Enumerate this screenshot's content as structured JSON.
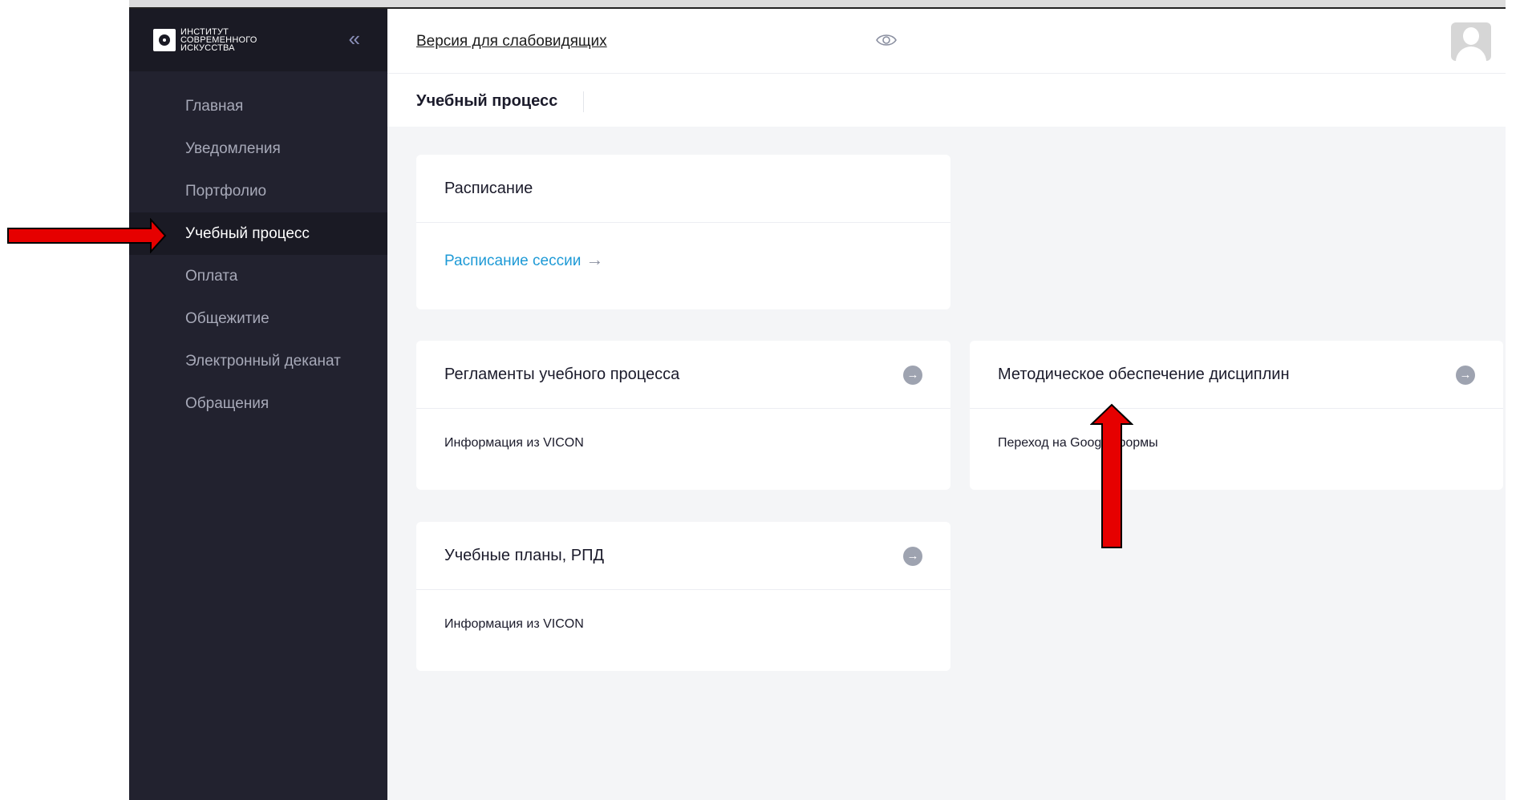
{
  "logo": {
    "lines": [
      "ИНСТИТУТ",
      "СОВРЕМЕННОГО",
      "ИСКУССТВА"
    ]
  },
  "sidebar": {
    "collapse_icon": "double-chevron-left",
    "items": [
      {
        "label": "Главная"
      },
      {
        "label": "Уведомления"
      },
      {
        "label": "Портфолио"
      },
      {
        "label": "Учебный процесс",
        "active": true
      },
      {
        "label": "Оплата"
      },
      {
        "label": "Общежитие"
      },
      {
        "label": "Электронный деканат"
      },
      {
        "label": "Обращения"
      }
    ]
  },
  "header": {
    "accessibility_link": "Версия для слабовидящих ",
    "accessibility_icon": "eye-icon",
    "avatar_icon": "user-avatar"
  },
  "page": {
    "title": "Учебный процесс"
  },
  "cards": {
    "schedule": {
      "title": "Расписание",
      "link": "Расписание сессии",
      "link_arrow": "→"
    },
    "regulations": {
      "title": "Регламенты учебного процесса",
      "body": "Информация из VICON"
    },
    "methodical": {
      "title": "Методическое обеспечение дисциплин",
      "body": "Переход на Google формы"
    },
    "plans": {
      "title": "Учебные планы, РПД",
      "body": "Информация из VICON"
    }
  },
  "colors": {
    "sidebar": "#22222f",
    "sidebar_active": "#1a1a24",
    "link": "#1e9ad6",
    "annotation_arrow": "#e60000"
  }
}
